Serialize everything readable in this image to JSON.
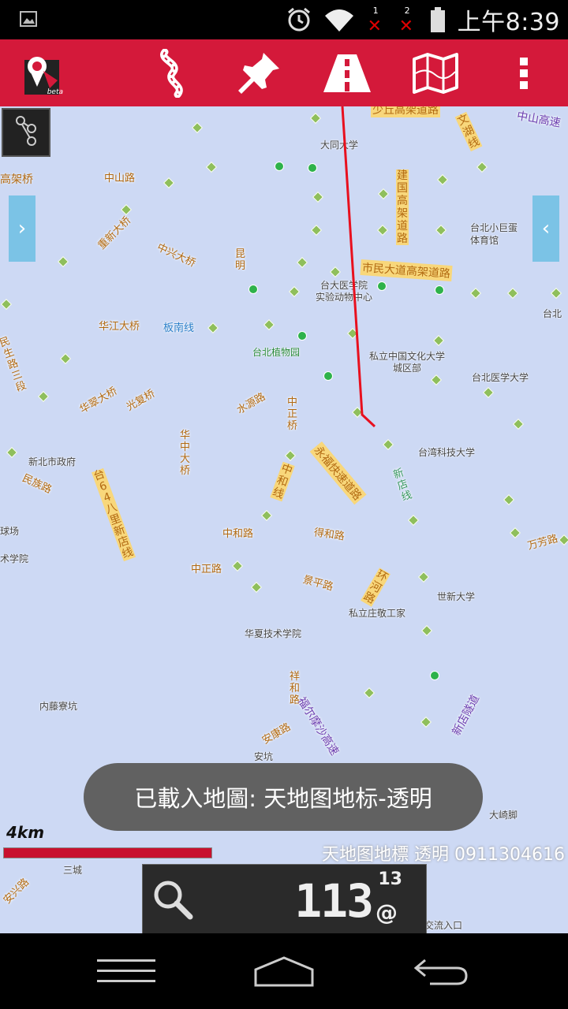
{
  "status_bar": {
    "time": "上午8:39",
    "sim1_label": "1",
    "sim2_label": "2",
    "icons": [
      "image-icon",
      "alarm-icon",
      "wifi-icon",
      "no-signal-icon",
      "no-signal-icon",
      "battery-icon"
    ]
  },
  "toolbar": {
    "app_logo_badge": "beta",
    "buttons": [
      "route-curve-icon",
      "pushpin-icon",
      "highway-icon",
      "map-icon",
      "overflow-menu-icon"
    ],
    "color": "#d4193a"
  },
  "map": {
    "labels": {
      "datong": "大同大学",
      "zhongshan_rd": "中山路",
      "gaojiaqiao": "高架桥",
      "chongxin_bridge": "重新大桥",
      "zhongxing_bridge": "中兴大桥",
      "kunming": "昆明",
      "ntu_hospital": "台大医学院\n实验动物中心",
      "shimin_hw": "市民大道高架道路",
      "jianguo_hw": "建国高架道路",
      "wenhu_line": "文湖线",
      "zhongshan_hw": "中山高速",
      "arena": "台北小巨蛋\n体育馆",
      "taibei": "台北",
      "huajiang_bridge": "华江大桥",
      "bannan_line": "板南线",
      "botanical": "台北植物园",
      "minsheng_rd": "民生路三段",
      "pccu": "私立中国文化大学\n城区部",
      "tmu": "台北医学大学",
      "huacui_bridge": "华翠大桥",
      "guangfu_bridge": "光复桥",
      "shuiyuan_rd": "水源路",
      "zhongzheng_bridge": "中正桥",
      "huazhong_bridge": "华中大桥",
      "yonghe_hw": "永福快速道路",
      "ntust": "台湾科技大学",
      "xindian_line": "新店线",
      "ntpc_gov": "新北市政府",
      "minzu_rd": "民族路",
      "tai64": "台64八里新店线",
      "zhonghe_line": "中和线",
      "baseball": "球场",
      "zhonghe_rd": "中和路",
      "dehe_rd": "得和路",
      "wanfang_rd": "万芳路",
      "academy": "术学院",
      "zhongzheng_rd": "中正路",
      "jingping_rd": "景平路",
      "huanhe_rd": "环河路",
      "shihsin": "世新大学",
      "chuangjing": "私立庄敬工家",
      "huaxia": "华夏技术学院",
      "xianghe_rd": "祥和路",
      "formosa_hw": "福尔摩沙高速",
      "xindian_hw": "新店隧道",
      "neicuokeng": "内藤寮坑",
      "ankang_rd": "安康路",
      "ankeng": "安坑",
      "daqijiao": "大崎脚",
      "sancheng": "三城",
      "highway_entry": "交流入口",
      "anxing": "安兴路"
    },
    "background_color": "#cdd9f4",
    "route_color": "#e8101e"
  },
  "toast": {
    "message": "已載入地圖: 天地图地标-透明"
  },
  "scale": {
    "label": "4km"
  },
  "layer": {
    "name": "天地图地標 透明 0911304616"
  },
  "info_panel": {
    "zoom_value": "113",
    "satellites": "13",
    "at_symbol": "@"
  },
  "nav_bar": {
    "buttons": [
      "menu-icon",
      "home-icon",
      "back-icon"
    ]
  }
}
